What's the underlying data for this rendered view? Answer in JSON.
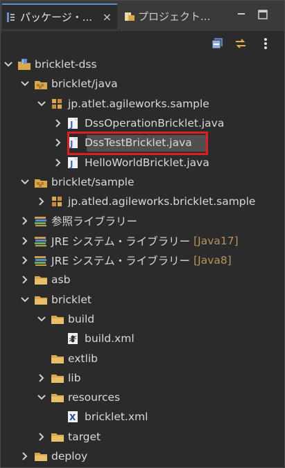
{
  "tabs": [
    {
      "label": "パッケージ・...",
      "icon": "package-explorer-icon",
      "close": "×",
      "active": true
    },
    {
      "label": "プロジェクト...",
      "icon": "project-explorer-icon",
      "active": false
    }
  ],
  "window_controls": [
    "minimize-icon",
    "maximize-icon"
  ],
  "toolbar": [
    "collapse-all-icon",
    "link-with-editor-icon",
    "view-menu-icon"
  ],
  "tree": [
    {
      "label": "bricklet-dss",
      "level": 0,
      "expanded": true,
      "icon": "java-project-icon"
    },
    {
      "label": "bricklet/java",
      "level": 1,
      "expanded": true,
      "icon": "source-folder-icon"
    },
    {
      "label": "jp.atlet.agileworks.sample",
      "level": 2,
      "expanded": true,
      "icon": "package-icon"
    },
    {
      "label": "DssOperationBricklet.java",
      "level": 3,
      "expanded": false,
      "icon": "java-file-icon"
    },
    {
      "label": "DssTestBricklet.java",
      "level": 3,
      "expanded": false,
      "icon": "java-file-icon",
      "selected": true
    },
    {
      "label": "HelloWorldBricklet.java",
      "level": 3,
      "expanded": false,
      "icon": "java-file-icon"
    },
    {
      "label": "bricklet/sample",
      "level": 1,
      "expanded": true,
      "icon": "source-folder-icon"
    },
    {
      "label": "jp.atled.agileworks.bricklet.sample",
      "level": 2,
      "expanded": false,
      "icon": "package-icon"
    },
    {
      "label": "参照ライブラリー",
      "level": 1,
      "expanded": false,
      "icon": "library-icon"
    },
    {
      "label": "JRE システム・ライブラリー",
      "decoration": "[Java17]",
      "level": 1,
      "expanded": false,
      "icon": "library-icon"
    },
    {
      "label": "JRE システム・ライブラリー",
      "decoration": "[Java8]",
      "level": 1,
      "expanded": false,
      "icon": "library-icon"
    },
    {
      "label": "asb",
      "level": 1,
      "expanded": false,
      "icon": "folder-icon"
    },
    {
      "label": "bricklet",
      "level": 1,
      "expanded": true,
      "icon": "folder-icon"
    },
    {
      "label": "build",
      "level": 2,
      "expanded": true,
      "icon": "folder-icon"
    },
    {
      "label": "build.xml",
      "level": 3,
      "leaf": true,
      "icon": "ant-xml-file-icon"
    },
    {
      "label": "extlib",
      "level": 2,
      "leaf": true,
      "icon": "folder-icon"
    },
    {
      "label": "lib",
      "level": 2,
      "expanded": false,
      "icon": "folder-icon"
    },
    {
      "label": "resources",
      "level": 2,
      "expanded": true,
      "icon": "folder-icon"
    },
    {
      "label": "bricklet.xml",
      "level": 3,
      "leaf": true,
      "icon": "xml-file-icon"
    },
    {
      "label": "target",
      "level": 2,
      "expanded": false,
      "icon": "folder-icon"
    },
    {
      "label": "deploy",
      "level": 1,
      "expanded": false,
      "icon": "folder-icon"
    }
  ],
  "colors": {
    "background": "#2b2b2b",
    "tabbar": "#3a3a3a",
    "text": "#d9d9d9",
    "decoration": "#b5945a",
    "highlight": "#e02020",
    "selection": "#505050"
  }
}
